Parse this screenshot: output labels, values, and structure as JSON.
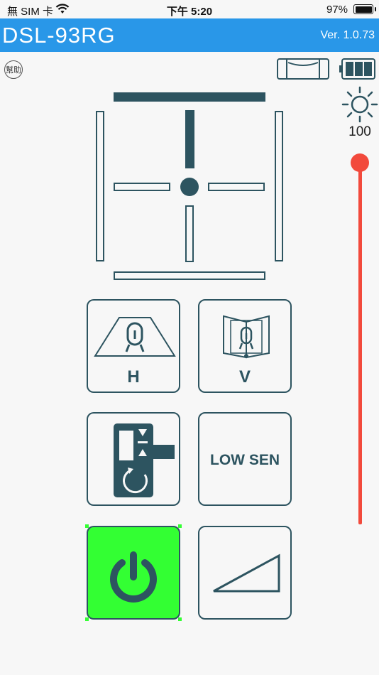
{
  "status_bar": {
    "carrier": "無 SIM 卡",
    "time": "下午 5:20",
    "battery_percent": "97%"
  },
  "header": {
    "title": "DSL-93RG",
    "version": "Ver. 1.0.73"
  },
  "help": {
    "label": "幫助"
  },
  "brightness": {
    "value": "100",
    "level": 1.0
  },
  "buttons": {
    "horizontal": {
      "label": "H"
    },
    "vertical": {
      "label": "V"
    },
    "low_sensitivity": {
      "label": "LOW SEN"
    }
  },
  "colors": {
    "header_bg": "#2997e8",
    "primary": "#2d5460",
    "power_active": "#33ff33",
    "slider": "#f24a3c"
  },
  "icons": [
    "wifi-icon",
    "level-vial-icon",
    "battery-3bar-icon",
    "sun-brightness-icon",
    "tripod-laser-icon",
    "receiver-remote-icon",
    "power-icon",
    "slope-triangle-icon"
  ]
}
